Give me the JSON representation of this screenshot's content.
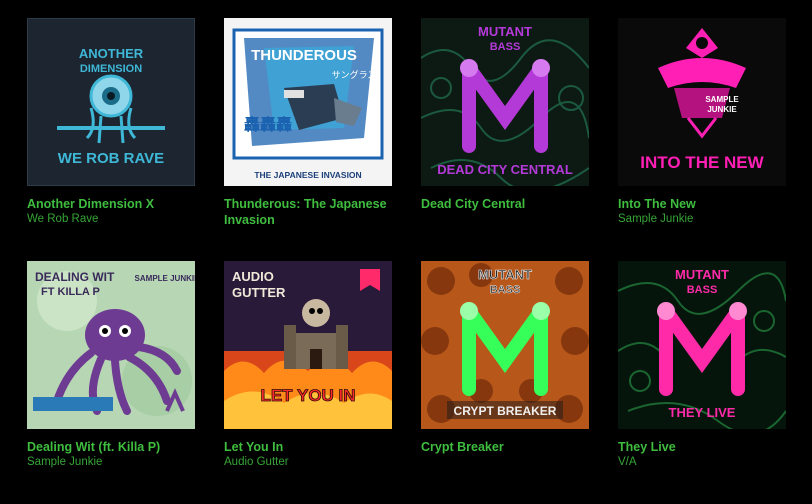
{
  "albums": [
    {
      "title": "Another Dimension X",
      "artist": "We Rob Rave",
      "cover_text": [
        "ANOTHER",
        "DIMENSION",
        "WE ROB RAVE"
      ],
      "colors": {
        "bg": "#1c2530",
        "accent": "#3fb8d8"
      }
    },
    {
      "title": "Thunderous: The Japanese Invasion",
      "artist": "",
      "cover_text": [
        "THUNDEROUS",
        "サングラス",
        "THE JAPANESE INVASION"
      ],
      "colors": {
        "bg": "#f4f4f4",
        "accent": "#1b63b0"
      }
    },
    {
      "title": "Dead City Central",
      "artist": "",
      "cover_text": [
        "MUTANT",
        "BASS",
        "DEAD CITY CENTRAL"
      ],
      "colors": {
        "bg": "#0d1a14",
        "accent": "#b43ad8"
      }
    },
    {
      "title": "Into The New",
      "artist": "Sample Junkie",
      "cover_text": [
        "SAMPLE",
        "JUNKIE",
        "INTO THE NEW"
      ],
      "colors": {
        "bg": "#0a0a0a",
        "accent": "#ff1fb4"
      }
    },
    {
      "title": "Dealing Wit (ft. Killa P)",
      "artist": "Sample Junkie",
      "cover_text": [
        "DEALING WIT",
        "FT KILLA P",
        "SAMPLE JUNKIE"
      ],
      "colors": {
        "bg": "#b6d6b4",
        "accent": "#6e3b92"
      }
    },
    {
      "title": "Let You In",
      "artist": "Audio Gutter",
      "cover_text": [
        "AUDIO",
        "GUTTER",
        "LET YOU IN"
      ],
      "colors": {
        "bg": "#2a1a3a",
        "accent": "#ff8a1a"
      }
    },
    {
      "title": "Crypt Breaker",
      "artist": "",
      "cover_text": [
        "MUTANT",
        "BASS",
        "CRYPT BREAKER"
      ],
      "colors": {
        "bg": "#b8571a",
        "accent": "#37ff5a"
      }
    },
    {
      "title": "They Live",
      "artist": "V/A",
      "cover_text": [
        "MUTANT",
        "BASS",
        "THEY LIVE"
      ],
      "colors": {
        "bg": "#06150c",
        "accent": "#ff2aa8"
      }
    }
  ]
}
